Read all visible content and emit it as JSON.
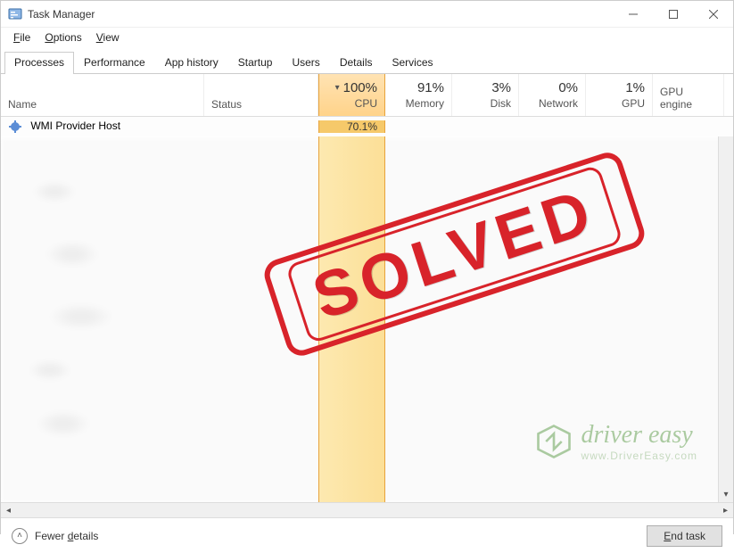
{
  "window": {
    "title": "Task Manager"
  },
  "menu": {
    "file": "File",
    "options": "Options",
    "view": "View"
  },
  "tabs": {
    "processes": "Processes",
    "performance": "Performance",
    "apphistory": "App history",
    "startup": "Startup",
    "users": "Users",
    "details": "Details",
    "services": "Services"
  },
  "columns": {
    "name": "Name",
    "status": "Status",
    "cpu": {
      "pct": "100%",
      "label": "CPU"
    },
    "memory": {
      "pct": "91%",
      "label": "Memory"
    },
    "disk": {
      "pct": "3%",
      "label": "Disk"
    },
    "network": {
      "pct": "0%",
      "label": "Network"
    },
    "gpu": {
      "pct": "1%",
      "label": "GPU"
    },
    "gpu_engine": "GPU engine"
  },
  "processes": [
    {
      "name": "WMI Provider Host",
      "cpu": "70.1%"
    }
  ],
  "footer": {
    "fewer": "Fewer details",
    "end_task": "End task"
  },
  "overlay": {
    "stamp": "SOLVED",
    "brand": "driver easy",
    "brand_url": "www.DriverEasy.com"
  }
}
